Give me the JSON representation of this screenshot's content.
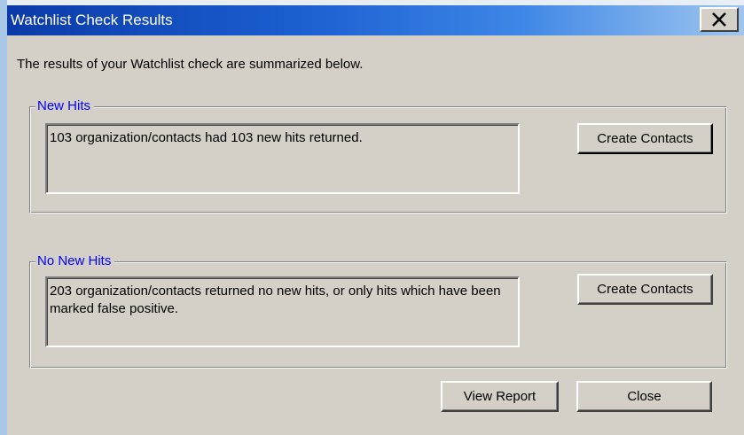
{
  "window": {
    "title": "Watchlist Check Results",
    "close_icon": "close-icon"
  },
  "intro_text": "The results of your Watchlist check are summarized below.",
  "new_hits": {
    "legend": "New Hits",
    "message": "103 organization/contacts had 103 new hits returned.",
    "button_label": "Create Contacts"
  },
  "no_new_hits": {
    "legend": "No New Hits",
    "message": "203 organization/contacts returned no new hits, or only hits which have been marked false positive.",
    "button_label": "Create Contacts"
  },
  "footer": {
    "view_report_label": "View Report",
    "close_label": "Close"
  },
  "colors": {
    "titlebar_start": "#0b3aa8",
    "titlebar_end": "#9fc6ef",
    "dialog_bg": "#d4d0c8",
    "legend_text": "#0000ff"
  }
}
